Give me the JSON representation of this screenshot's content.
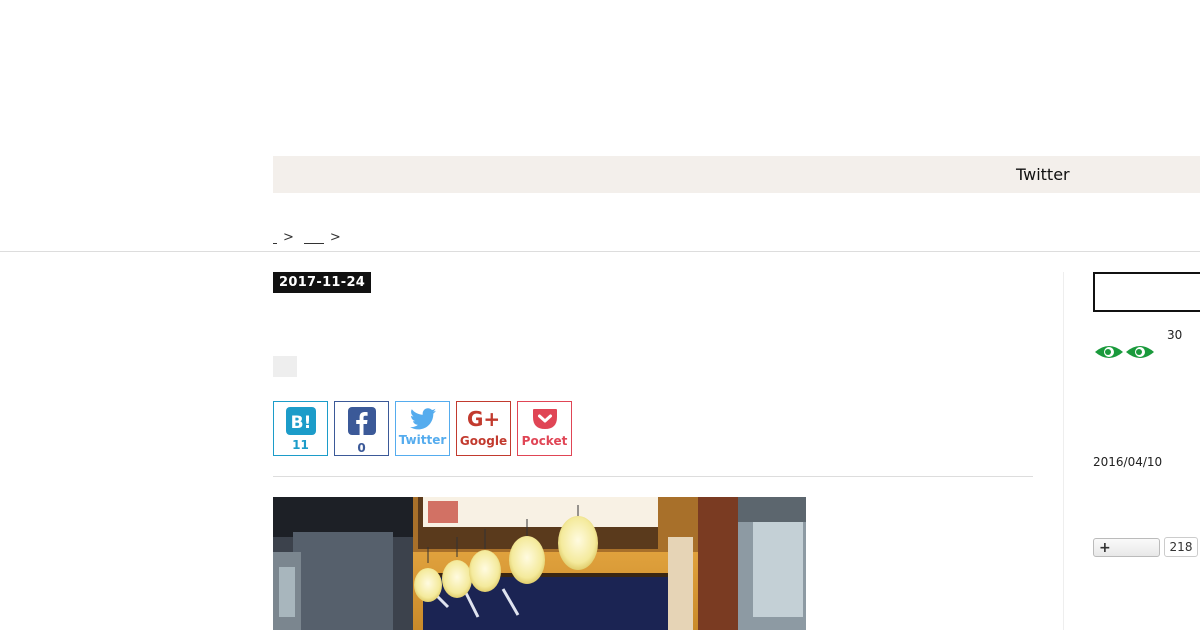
{
  "nav": {
    "twitter_label": "Twitter"
  },
  "breadcrumb": {
    "sep1": ">",
    "sep2": ">"
  },
  "article": {
    "date": "2017-11-24"
  },
  "share": {
    "hatena": {
      "count": "11",
      "icon": "hatena-bookmark-icon"
    },
    "facebook": {
      "count": "0",
      "icon": "facebook-icon"
    },
    "twitter": {
      "label": "Twitter",
      "icon": "twitter-bird-icon"
    },
    "google": {
      "label": "Google",
      "icon": "google-plus-icon"
    },
    "pocket": {
      "label": "Pocket",
      "icon": "pocket-icon"
    }
  },
  "sidebar": {
    "counter": "30",
    "date": "2016/04/10",
    "follow_count": "218"
  },
  "colors": {
    "hatena": "#1c9cc9",
    "facebook": "#3b5998",
    "twitter": "#55acee",
    "google": "#c23a2e",
    "pocket": "#e04555",
    "eyes": "#1a9a3c"
  }
}
